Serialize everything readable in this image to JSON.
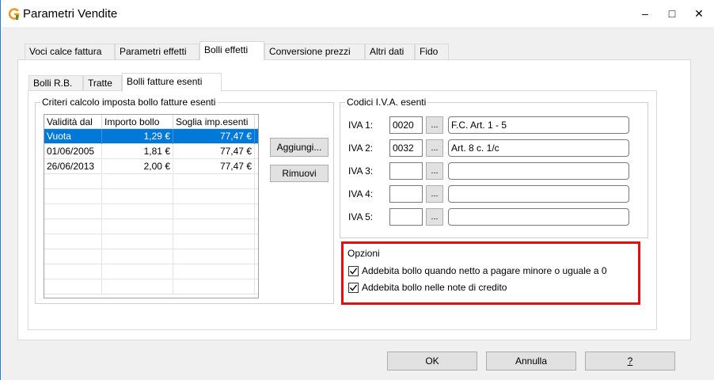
{
  "window": {
    "title": "Parametri Vendite",
    "min_icon": "minimize-icon",
    "max_icon": "maximize-icon",
    "close_icon": "close-icon",
    "min_glyph": "–",
    "max_glyph": "□",
    "close_glyph": "✕"
  },
  "tabs": [
    {
      "label": "Voci calce fattura"
    },
    {
      "label": "Parametri effetti"
    },
    {
      "label": "Bolli effetti"
    },
    {
      "label": "Conversione prezzi"
    },
    {
      "label": "Altri dati"
    },
    {
      "label": "Fido"
    }
  ],
  "subtabs": [
    {
      "label": "Bolli R.B."
    },
    {
      "label": "Tratte"
    },
    {
      "label": "Bolli fatture esenti"
    }
  ],
  "criteri": {
    "legend": "Criteri calcolo imposta bollo fatture esenti",
    "columns": [
      "Validità dal",
      "Importo bollo",
      "Soglia imp.esenti"
    ],
    "rows": [
      [
        "Vuota",
        "1,29 €",
        "77,47 €"
      ],
      [
        "01/06/2005",
        "1,81 €",
        "77,47 €"
      ],
      [
        "26/06/2013",
        "2,00 €",
        "77,47 €"
      ]
    ],
    "add_button": "Aggiungi...",
    "remove_button": "Rimuovi"
  },
  "codici": {
    "legend": "Codici I.V.A. esenti",
    "rows": [
      {
        "label": "IVA 1:",
        "code": "0020",
        "desc": "F.C. Art. 1 - 5",
        "browse": "..."
      },
      {
        "label": "IVA 2:",
        "code": "0032",
        "desc": "Art. 8 c. 1/c",
        "browse": "..."
      },
      {
        "label": "IVA 3:",
        "code": "",
        "desc": "",
        "browse": "..."
      },
      {
        "label": "IVA 4:",
        "code": "",
        "desc": "",
        "browse": "..."
      },
      {
        "label": "IVA 5:",
        "code": "",
        "desc": "",
        "browse": "..."
      }
    ]
  },
  "opzioni": {
    "legend": "Opzioni",
    "options": [
      {
        "label": "Addebita bollo quando netto a pagare minore o uguale a 0",
        "checked": true
      },
      {
        "label": "Addebita bollo nelle note di credito",
        "checked": true
      }
    ],
    "highlight_color": "#e01010"
  },
  "footer": {
    "ok": "OK",
    "annulla": "Annulla",
    "help": "?"
  },
  "colors": {
    "selection": "#0078d7",
    "window_border": "#2b79d8",
    "logo_orange": "#f29a1f"
  }
}
